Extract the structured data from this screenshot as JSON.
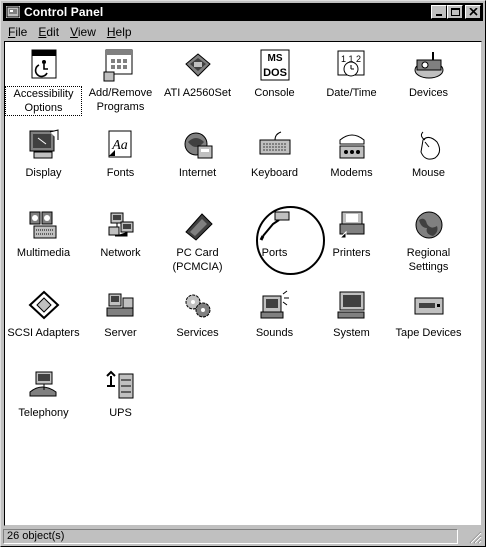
{
  "window": {
    "title": "Control Panel"
  },
  "menu": {
    "file": "ile",
    "file_key": "F",
    "edit": "dit",
    "edit_key": "E",
    "view": "iew",
    "view_key": "V",
    "help": "elp",
    "help_key": "H"
  },
  "items": [
    {
      "label": "Accessibility Options",
      "icon": "accessibility-icon"
    },
    {
      "label": "Add/Remove Programs",
      "icon": "add-remove-programs-icon"
    },
    {
      "label": "ATI A2560Set",
      "icon": "ati-display-icon"
    },
    {
      "label": "Console",
      "icon": "console-icon"
    },
    {
      "label": "Date/Time",
      "icon": "date-time-icon"
    },
    {
      "label": "Devices",
      "icon": "devices-icon"
    },
    {
      "label": "Display",
      "icon": "display-icon"
    },
    {
      "label": "Fonts",
      "icon": "fonts-icon"
    },
    {
      "label": "Internet",
      "icon": "internet-icon"
    },
    {
      "label": "Keyboard",
      "icon": "keyboard-icon"
    },
    {
      "label": "Modems",
      "icon": "modem-icon"
    },
    {
      "label": "Mouse",
      "icon": "mouse-icon"
    },
    {
      "label": "Multimedia",
      "icon": "multimedia-icon"
    },
    {
      "label": "Network",
      "icon": "network-icon"
    },
    {
      "label": "PC Card (PCMCIA)",
      "icon": "pc-card-icon"
    },
    {
      "label": "Ports",
      "icon": "ports-icon"
    },
    {
      "label": "Printers",
      "icon": "printers-icon"
    },
    {
      "label": "Regional Settings",
      "icon": "globe-icon"
    },
    {
      "label": "SCSI Adapters",
      "icon": "scsi-icon"
    },
    {
      "label": "Server",
      "icon": "server-icon"
    },
    {
      "label": "Services",
      "icon": "services-icon"
    },
    {
      "label": "Sounds",
      "icon": "sounds-icon"
    },
    {
      "label": "System",
      "icon": "system-icon"
    },
    {
      "label": "Tape Devices",
      "icon": "tape-devices-icon"
    },
    {
      "label": "Telephony",
      "icon": "telephony-icon"
    },
    {
      "label": "UPS",
      "icon": "ups-icon"
    }
  ],
  "status": {
    "text": "26 object(s)"
  },
  "colors": {
    "titlebar": "#000000",
    "face": "#c0c0c0",
    "window_bg": "#ffffff"
  }
}
